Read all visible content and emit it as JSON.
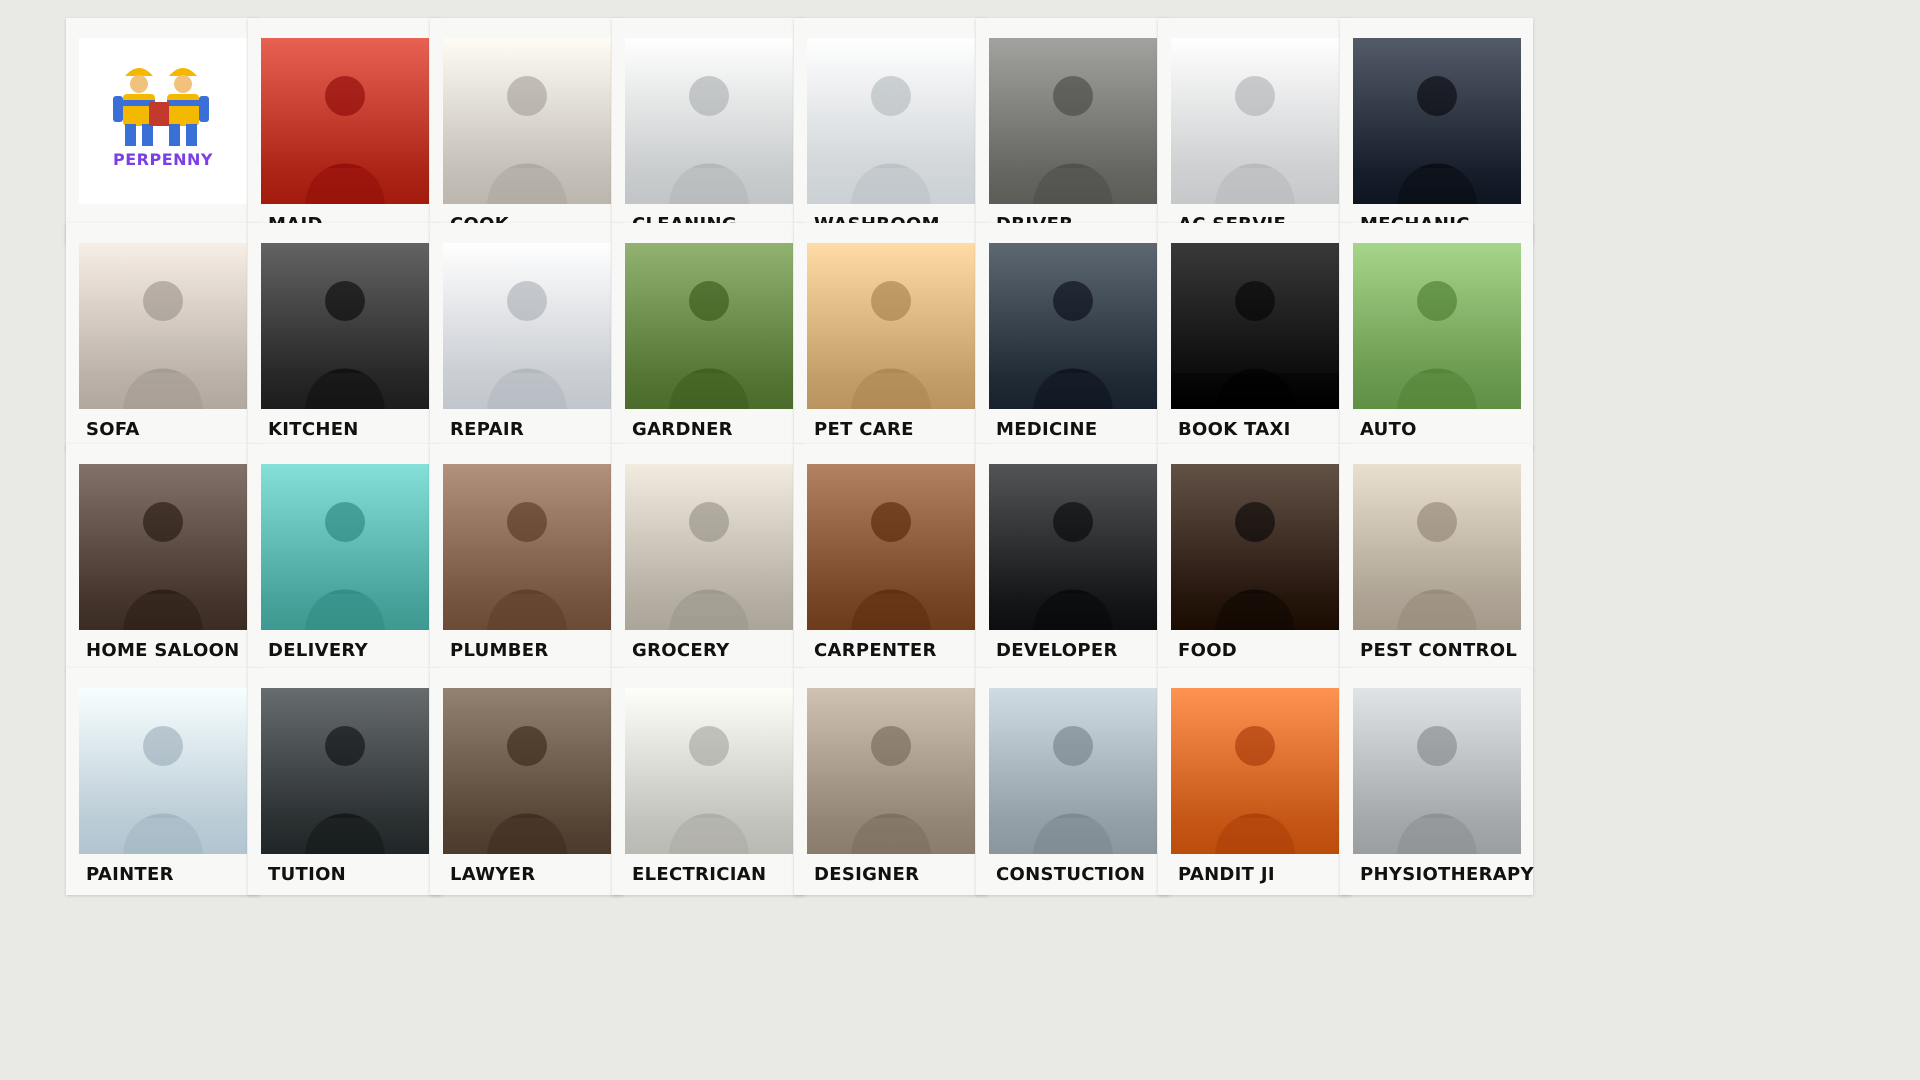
{
  "brand": {
    "name": "PERPENNY",
    "color": "#7b3fe4",
    "icon": "workers-logo-icon"
  },
  "services": [
    {
      "label": "",
      "is_logo": true
    },
    {
      "label": "MAID",
      "icon": "maid-photo",
      "color": "#c0392b"
    },
    {
      "label": "COOK",
      "icon": "chef-photo",
      "color": "#d9d4cc"
    },
    {
      "label": "CLEANING",
      "icon": "mopping-photo",
      "color": "#dfe3e4"
    },
    {
      "label": "WASHROOM",
      "icon": "sink-cleaning-photo",
      "color": "#e8eef2"
    },
    {
      "label": "DRIVER",
      "icon": "car-driver-photo",
      "color": "#7a7a76"
    },
    {
      "label": "AC SERVIE",
      "icon": "ac-unit-photo",
      "color": "#e4e6e8"
    },
    {
      "label": "MECHANIC",
      "icon": "mechanic-photo",
      "color": "#2c3340"
    },
    {
      "label": "SOFA",
      "icon": "sofa-vacuum-photo",
      "color": "#cfc6bd"
    },
    {
      "label": "KITCHEN",
      "icon": "stove-cleaning-photo",
      "color": "#3b3b3b"
    },
    {
      "label": "REPAIR",
      "icon": "washer-repair-photo",
      "color": "#dfe4ea"
    },
    {
      "label": "GARDNER",
      "icon": "garden-photo",
      "color": "#6a8a4a"
    },
    {
      "label": "PET CARE",
      "icon": "dog-walking-photo",
      "color": "#d8b37e"
    },
    {
      "label": "MEDICINE",
      "icon": "medicine-box-photo",
      "color": "#36404a"
    },
    {
      "label": "BOOK TAXI",
      "icon": "taxi-sign-photo",
      "color": "#111111"
    },
    {
      "label": "AUTO",
      "icon": "auto-rickshaw-photo",
      "color": "#7fae63"
    },
    {
      "label": "HOME SALOON",
      "icon": "hair-salon-photo",
      "color": "#5a4a42"
    },
    {
      "label": "DELIVERY",
      "icon": "parcel-delivery-photo",
      "color": "#5cb8b0"
    },
    {
      "label": "PLUMBER",
      "icon": "plumber-photo",
      "color": "#8a6a55"
    },
    {
      "label": "GROCERY",
      "icon": "grocery-delivery-photo",
      "color": "#c9c3b8"
    },
    {
      "label": "CARPENTER",
      "icon": "carpenter-photo",
      "color": "#8a5a3a"
    },
    {
      "label": "DEVELOPER",
      "icon": "laptop-code-photo",
      "color": "#2a2c2e"
    },
    {
      "label": "FOOD",
      "icon": "food-bowls-photo",
      "color": "#3a2a1e"
    },
    {
      "label": "PEST CONTROL",
      "icon": "pest-spray-photo",
      "color": "#c2b8a8"
    },
    {
      "label": "PAINTER",
      "icon": "wall-painter-photo",
      "color": "#cfe2ee"
    },
    {
      "label": "TUTION",
      "icon": "tutor-photo",
      "color": "#3f4446"
    },
    {
      "label": "LAWYER",
      "icon": "lawyer-desk-photo",
      "color": "#6b5a4a"
    },
    {
      "label": "ELECTRICIAN",
      "icon": "electrician-photo",
      "color": "#d8d8d2"
    },
    {
      "label": "DESIGNER",
      "icon": "designers-table-photo",
      "color": "#a89a8a"
    },
    {
      "label": "CONSTUCTION",
      "icon": "construction-site-photo",
      "color": "#a8b4bc"
    },
    {
      "label": "PANDIT JI",
      "icon": "pandit-photo",
      "color": "#d96b2a"
    },
    {
      "label": "PHYSIOTHERAPY",
      "icon": "physio-photo",
      "color": "#b8bcbf"
    }
  ]
}
